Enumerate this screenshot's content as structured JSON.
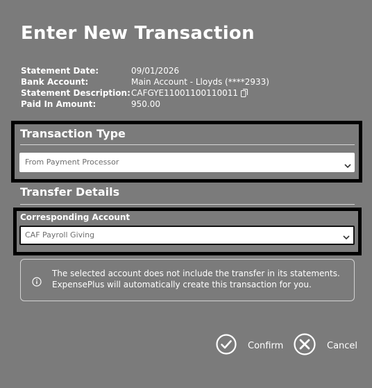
{
  "dialog": {
    "title": "Enter New Transaction"
  },
  "details": [
    {
      "label": "Statement Date:",
      "value": "09/01/2026"
    },
    {
      "label": "Bank Account:",
      "value": "Main Account - Lloyds (****2933)"
    },
    {
      "label": "Statement Description:",
      "value": "CAFGYE11001100110011"
    },
    {
      "label": "Paid In Amount:",
      "value": "950.00"
    }
  ],
  "transaction_type": {
    "heading": "Transaction Type",
    "selected": "From Payment Processor"
  },
  "transfer_details": {
    "heading": "Transfer Details",
    "account_label": "Corresponding Account",
    "account_selected": "CAF Payroll Giving"
  },
  "notice": {
    "icon": "info-icon",
    "line1": "The selected account does not include the transfer in its statements.",
    "line2": "ExpensePlus will automatically create this transaction for you."
  },
  "actions": {
    "confirm_label": "Confirm",
    "confirm_icon": "check-circle-icon",
    "cancel_label": "Cancel",
    "cancel_icon": "x-circle-icon"
  },
  "colors": {
    "background": "#7b7b7b",
    "text": "#ffffff",
    "highlight_border": "#000000",
    "select_background": "#ffffff",
    "select_text": "#6e6e6e"
  }
}
